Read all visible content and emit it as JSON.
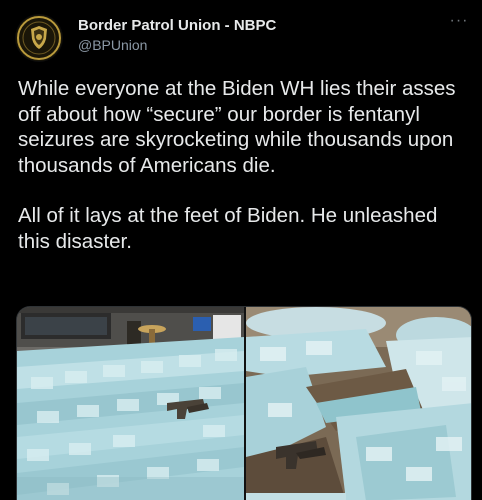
{
  "account": {
    "display_name": "Border Patrol Union - NBPC",
    "handle": "@BPUnion",
    "avatar_icon": "union-seal-logo",
    "more_icon": "more-options-icon",
    "more_glyph": "···"
  },
  "tweet": {
    "paragraphs": [
      "While everyone at the Biden WH lies their asses off about how “secure” our border is fentanyl seizures are skyrocketing while thousands upon thousands of Americans die.",
      "All of it lays at the feet of Biden. He unleashed this disaster."
    ]
  },
  "media": {
    "photos": [
      {
        "name": "photo-left"
      },
      {
        "name": "photo-right"
      }
    ]
  },
  "colors": {
    "background": "#000000",
    "text": "#e7e9ea",
    "secondary": "#8b98a5",
    "pill_blue": "#a9d8e0"
  }
}
